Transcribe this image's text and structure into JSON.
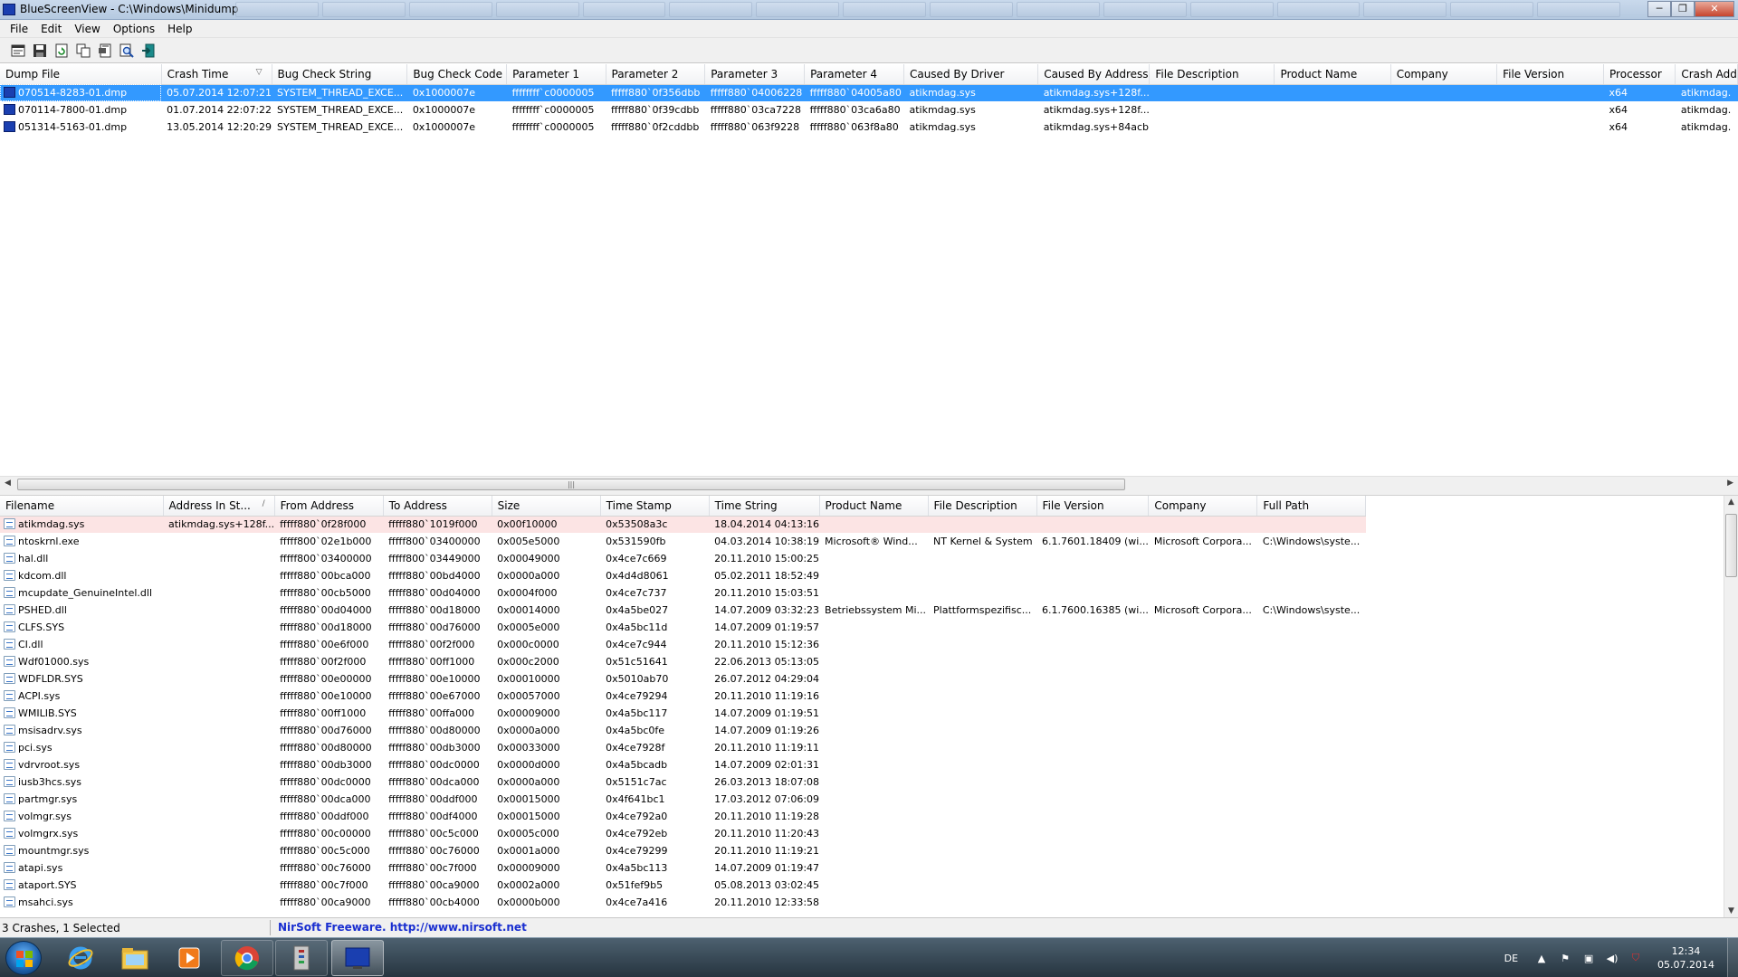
{
  "window": {
    "title": "BlueScreenView  -  C:\\Windows\\Minidump",
    "minimize": "─",
    "maximize": "❐",
    "close": "✕"
  },
  "menu": [
    "File",
    "Edit",
    "View",
    "Options",
    "Help"
  ],
  "toolbar": {
    "icons": [
      "properties-icon",
      "save-icon",
      "refresh-icon",
      "copy-icon",
      "html-report-icon",
      "find-icon",
      "exit-icon"
    ]
  },
  "crashes": {
    "columns": [
      "Dump File",
      "Crash Time",
      "Bug Check String",
      "Bug Check Code",
      "Parameter 1",
      "Parameter 2",
      "Parameter 3",
      "Parameter 4",
      "Caused By Driver",
      "Caused By Address",
      "File Description",
      "Product Name",
      "Company",
      "File Version",
      "Processor",
      "Crash Add"
    ],
    "sort_indicator": "▽",
    "rows": [
      [
        "070514-8283-01.dmp",
        "05.07.2014 12:07:21",
        "SYSTEM_THREAD_EXCE...",
        "0x1000007e",
        "ffffffff`c0000005",
        "fffff880`0f356dbb",
        "fffff880`04006228",
        "fffff880`04005a80",
        "atikmdag.sys",
        "atikmdag.sys+128f...",
        "",
        "",
        "",
        "",
        "x64",
        "atikmdag."
      ],
      [
        "070114-7800-01.dmp",
        "01.07.2014 22:07:22",
        "SYSTEM_THREAD_EXCE...",
        "0x1000007e",
        "ffffffff`c0000005",
        "fffff880`0f39cdbb",
        "fffff880`03ca7228",
        "fffff880`03ca6a80",
        "atikmdag.sys",
        "atikmdag.sys+128f...",
        "",
        "",
        "",
        "",
        "x64",
        "atikmdag."
      ],
      [
        "051314-5163-01.dmp",
        "13.05.2014 12:20:29",
        "SYSTEM_THREAD_EXCE...",
        "0x1000007e",
        "ffffffff`c0000005",
        "fffff880`0f2cddbb",
        "fffff880`063f9228",
        "fffff880`063f8a80",
        "atikmdag.sys",
        "atikmdag.sys+84acb",
        "",
        "",
        "",
        "",
        "x64",
        "atikmdag."
      ]
    ]
  },
  "modules": {
    "columns": [
      "Filename",
      "Address In St...",
      "From Address",
      "To Address",
      "Size",
      "Time Stamp",
      "Time String",
      "Product Name",
      "File Description",
      "File Version",
      "Company",
      "Full Path"
    ],
    "sort_indicator": "/",
    "rows": [
      [
        "atikmdag.sys",
        "atikmdag.sys+128f...",
        "fffff880`0f28f000",
        "fffff880`1019f000",
        "0x00f10000",
        "0x53508a3c",
        "18.04.2014 04:13:16",
        "",
        "",
        "",
        "",
        ""
      ],
      [
        "ntoskrnl.exe",
        "",
        "fffff800`02e1b000",
        "fffff800`03400000",
        "0x005e5000",
        "0x531590fb",
        "04.03.2014 10:38:19",
        "Microsoft® Wind...",
        "NT Kernel & System",
        "6.1.7601.18409 (wi...",
        "Microsoft Corpora...",
        "C:\\Windows\\syste..."
      ],
      [
        "hal.dll",
        "",
        "fffff800`03400000",
        "fffff800`03449000",
        "0x00049000",
        "0x4ce7c669",
        "20.11.2010 15:00:25",
        "",
        "",
        "",
        "",
        ""
      ],
      [
        "kdcom.dll",
        "",
        "fffff880`00bca000",
        "fffff880`00bd4000",
        "0x0000a000",
        "0x4d4d8061",
        "05.02.2011 18:52:49",
        "",
        "",
        "",
        "",
        ""
      ],
      [
        "mcupdate_GenuineIntel.dll",
        "",
        "fffff880`00cb5000",
        "fffff880`00d04000",
        "0x0004f000",
        "0x4ce7c737",
        "20.11.2010 15:03:51",
        "",
        "",
        "",
        "",
        ""
      ],
      [
        "PSHED.dll",
        "",
        "fffff880`00d04000",
        "fffff880`00d18000",
        "0x00014000",
        "0x4a5be027",
        "14.07.2009 03:32:23",
        "Betriebssystem Mi...",
        "Plattformspezifisc...",
        "6.1.7600.16385 (wi...",
        "Microsoft Corpora...",
        "C:\\Windows\\syste..."
      ],
      [
        "CLFS.SYS",
        "",
        "fffff880`00d18000",
        "fffff880`00d76000",
        "0x0005e000",
        "0x4a5bc11d",
        "14.07.2009 01:19:57",
        "",
        "",
        "",
        "",
        ""
      ],
      [
        "CI.dll",
        "",
        "fffff880`00e6f000",
        "fffff880`00f2f000",
        "0x000c0000",
        "0x4ce7c944",
        "20.11.2010 15:12:36",
        "",
        "",
        "",
        "",
        ""
      ],
      [
        "Wdf01000.sys",
        "",
        "fffff880`00f2f000",
        "fffff880`00ff1000",
        "0x000c2000",
        "0x51c51641",
        "22.06.2013 05:13:05",
        "",
        "",
        "",
        "",
        ""
      ],
      [
        "WDFLDR.SYS",
        "",
        "fffff880`00e00000",
        "fffff880`00e10000",
        "0x00010000",
        "0x5010ab70",
        "26.07.2012 04:29:04",
        "",
        "",
        "",
        "",
        ""
      ],
      [
        "ACPI.sys",
        "",
        "fffff880`00e10000",
        "fffff880`00e67000",
        "0x00057000",
        "0x4ce79294",
        "20.11.2010 11:19:16",
        "",
        "",
        "",
        "",
        ""
      ],
      [
        "WMILIB.SYS",
        "",
        "fffff880`00ff1000",
        "fffff880`00ffa000",
        "0x00009000",
        "0x4a5bc117",
        "14.07.2009 01:19:51",
        "",
        "",
        "",
        "",
        ""
      ],
      [
        "msisadrv.sys",
        "",
        "fffff880`00d76000",
        "fffff880`00d80000",
        "0x0000a000",
        "0x4a5bc0fe",
        "14.07.2009 01:19:26",
        "",
        "",
        "",
        "",
        ""
      ],
      [
        "pci.sys",
        "",
        "fffff880`00d80000",
        "fffff880`00db3000",
        "0x00033000",
        "0x4ce7928f",
        "20.11.2010 11:19:11",
        "",
        "",
        "",
        "",
        ""
      ],
      [
        "vdrvroot.sys",
        "",
        "fffff880`00db3000",
        "fffff880`00dc0000",
        "0x0000d000",
        "0x4a5bcadb",
        "14.07.2009 02:01:31",
        "",
        "",
        "",
        "",
        ""
      ],
      [
        "iusb3hcs.sys",
        "",
        "fffff880`00dc0000",
        "fffff880`00dca000",
        "0x0000a000",
        "0x5151c7ac",
        "26.03.2013 18:07:08",
        "",
        "",
        "",
        "",
        ""
      ],
      [
        "partmgr.sys",
        "",
        "fffff880`00dca000",
        "fffff880`00ddf000",
        "0x00015000",
        "0x4f641bc1",
        "17.03.2012 07:06:09",
        "",
        "",
        "",
        "",
        ""
      ],
      [
        "volmgr.sys",
        "",
        "fffff880`00ddf000",
        "fffff880`00df4000",
        "0x00015000",
        "0x4ce792a0",
        "20.11.2010 11:19:28",
        "",
        "",
        "",
        "",
        ""
      ],
      [
        "volmgrx.sys",
        "",
        "fffff880`00c00000",
        "fffff880`00c5c000",
        "0x0005c000",
        "0x4ce792eb",
        "20.11.2010 11:20:43",
        "",
        "",
        "",
        "",
        ""
      ],
      [
        "mountmgr.sys",
        "",
        "fffff880`00c5c000",
        "fffff880`00c76000",
        "0x0001a000",
        "0x4ce79299",
        "20.11.2010 11:19:21",
        "",
        "",
        "",
        "",
        ""
      ],
      [
        "atapi.sys",
        "",
        "fffff880`00c76000",
        "fffff880`00c7f000",
        "0x00009000",
        "0x4a5bc113",
        "14.07.2009 01:19:47",
        "",
        "",
        "",
        "",
        ""
      ],
      [
        "ataport.SYS",
        "",
        "fffff880`00c7f000",
        "fffff880`00ca9000",
        "0x0002a000",
        "0x51fef9b5",
        "05.08.2013 03:02:45",
        "",
        "",
        "",
        "",
        ""
      ],
      [
        "msahci.sys",
        "",
        "fffff880`00ca9000",
        "fffff880`00cb4000",
        "0x0000b000",
        "0x4ce7a416",
        "20.11.2010 12:33:58",
        "",
        "",
        "",
        "",
        ""
      ]
    ]
  },
  "statusbar": {
    "summary": "3 Crashes, 1 Selected",
    "link": "NirSoft Freeware.  http://www.nirsoft.net"
  },
  "taskbar": {
    "apps": [
      "internet-explorer-icon",
      "explorer-folder-icon",
      "media-player-icon",
      "chrome-icon",
      "archive-tool-icon",
      "bluescreenview-icon"
    ],
    "language": "DE",
    "time": "12:34",
    "date": "05.07.2014"
  },
  "colors": {
    "selection": "#3399ff",
    "highlight_row": "#fce4e4",
    "link": "#1a2fd0"
  }
}
